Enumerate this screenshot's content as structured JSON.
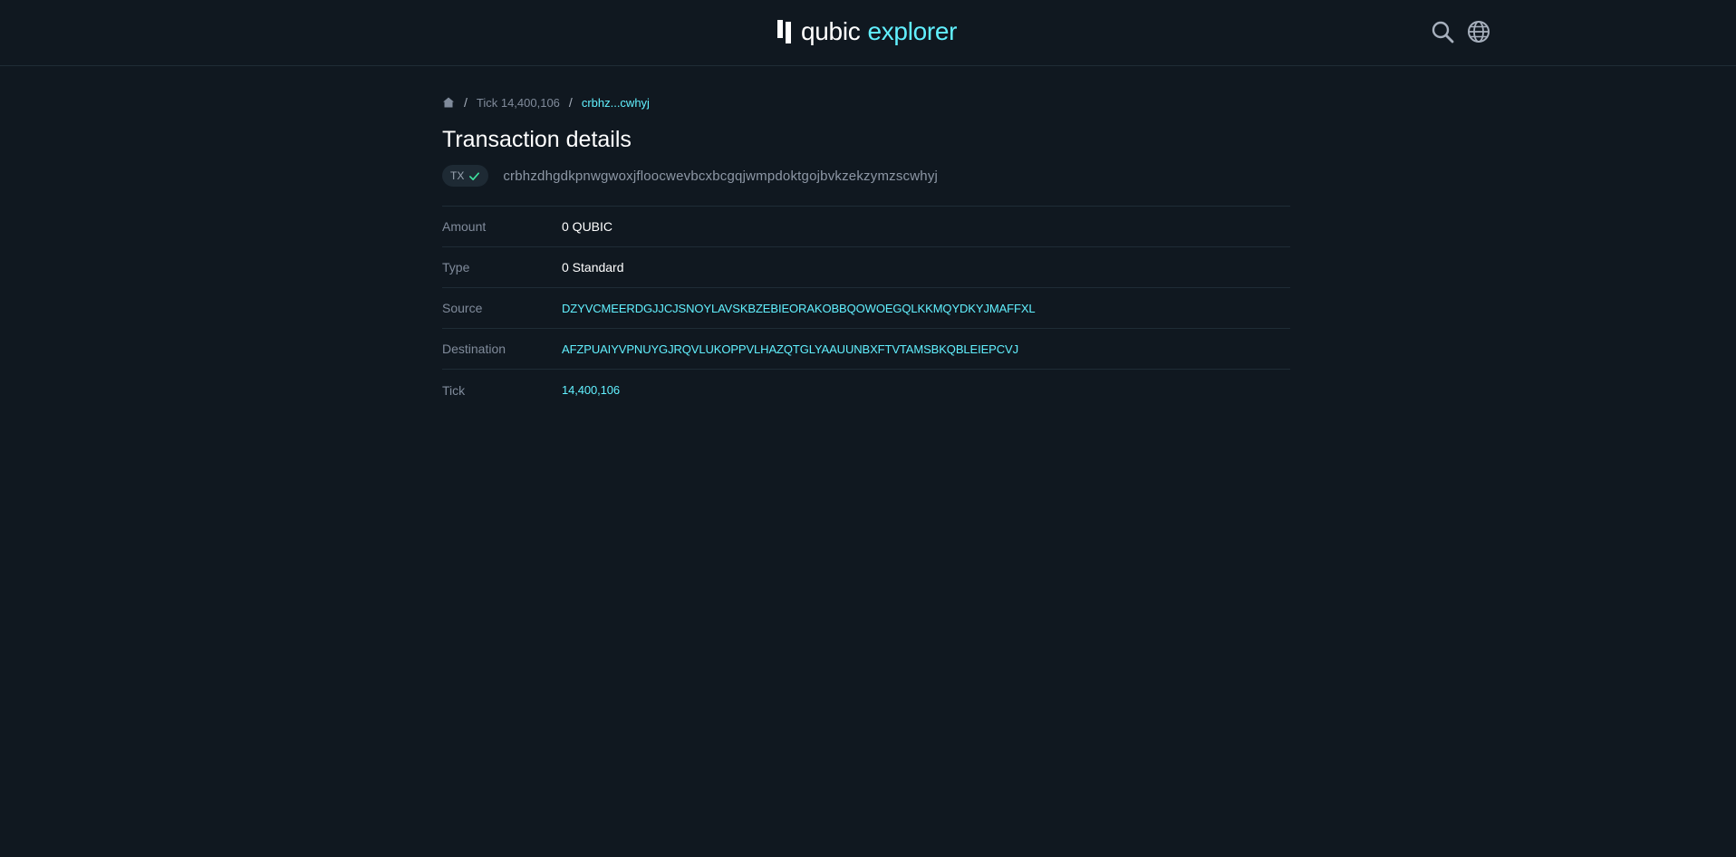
{
  "header": {
    "logo_primary": "qubic",
    "logo_secondary": "explorer",
    "search_icon": "search-icon",
    "language_icon": "globe-icon"
  },
  "breadcrumb": {
    "home_icon": "home-icon",
    "tick_label": "Tick 14,400,106",
    "current": "crbhz...cwhyj"
  },
  "page": {
    "title": "Transaction details",
    "badge_label": "TX",
    "badge_icon": "check-icon",
    "tx_hash": "crbhzdhgdkpnwgwoxjfloocwevbcxbcgqjwmpdoktgojbvkzekzymzscwhyj"
  },
  "details": [
    {
      "label": "Amount",
      "value": "0 QUBIC"
    },
    {
      "label": "Type",
      "value": "0 Standard"
    },
    {
      "label": "Source",
      "value": "DZYVCMEERDGJJCJSNOYLAVSKBZEBIEORAKOBBQOWOEGQLKKMQYDKYJMAFFXL"
    },
    {
      "label": "Destination",
      "value": "AFZPUAIYVPNUYGJRQVLUKOPPVLHAZQTGLYAAUUNBXFTVTAMSBKQBLEIEPCVJ"
    },
    {
      "label": "Tick",
      "value": "14,400,106"
    }
  ],
  "colors": {
    "background": "#101820",
    "accent": "#61f0fe",
    "success": "#3ee3a0",
    "muted": "#808b9b",
    "divider": "#1f2c36"
  }
}
